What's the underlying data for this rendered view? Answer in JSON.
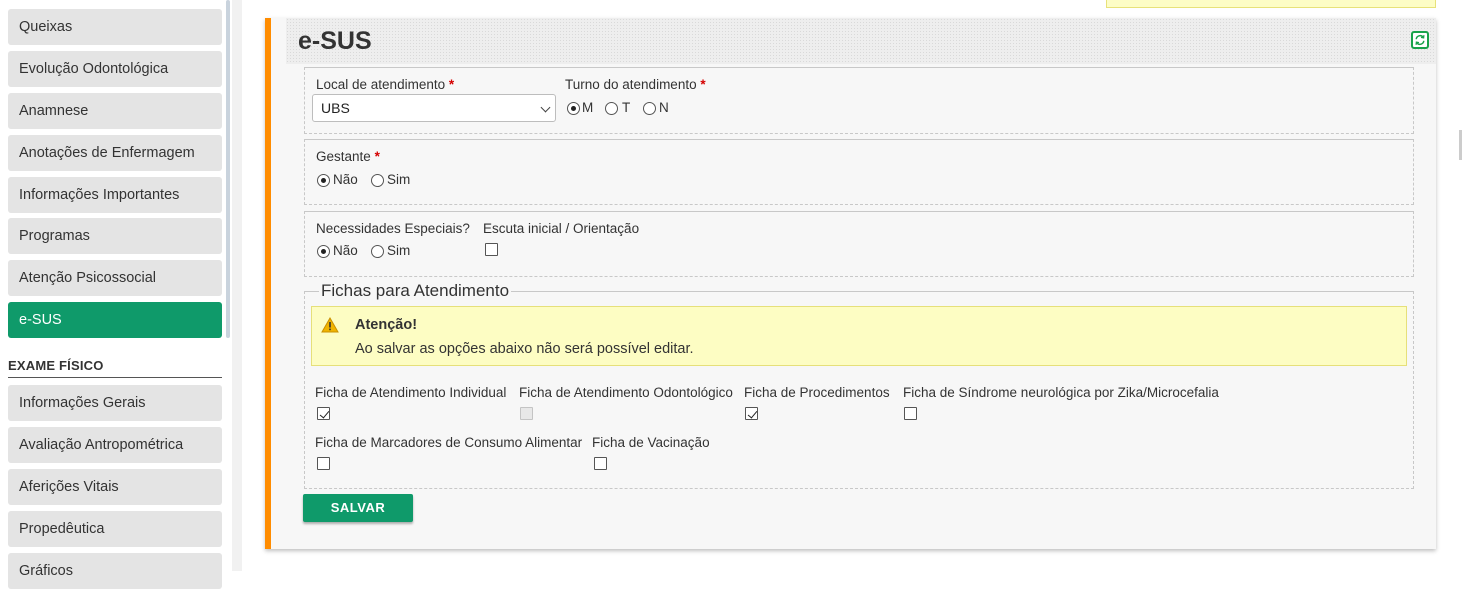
{
  "sidebar": {
    "items": [
      {
        "label": "Queixas"
      },
      {
        "label": "Evolução Odontológica"
      },
      {
        "label": "Anamnese"
      },
      {
        "label": "Anotações de Enfermagem"
      },
      {
        "label": "Informações Importantes"
      },
      {
        "label": "Programas"
      },
      {
        "label": "Atenção Psicossocial"
      },
      {
        "label": "e-SUS",
        "active": true
      }
    ],
    "section_title": "EXAME FÍSICO",
    "exam_items": [
      {
        "label": "Informações Gerais"
      },
      {
        "label": "Avaliação Antropométrica"
      },
      {
        "label": "Aferições Vitais"
      },
      {
        "label": "Propedêutica"
      },
      {
        "label": "Gráficos"
      }
    ]
  },
  "panel": {
    "title": "e-SUS",
    "refresh_icon": "refresh-icon",
    "accent_color": "#ff8c00"
  },
  "form": {
    "local": {
      "label": "Local de atendimento",
      "required": "*",
      "value": "UBS"
    },
    "turno": {
      "label": "Turno do atendimento",
      "required": "*",
      "options": [
        "M",
        "T",
        "N"
      ],
      "selected": "M"
    },
    "gestante": {
      "label": "Gestante",
      "required": "*",
      "options": [
        "Não",
        "Sim"
      ],
      "selected": "Não"
    },
    "necessidades": {
      "label": "Necessidades Especiais?",
      "options": [
        "Não",
        "Sim"
      ],
      "selected": "Não"
    },
    "escuta": {
      "label": "Escuta inicial / Orientação",
      "checked": false
    }
  },
  "fichas": {
    "legend": "Fichas para Atendimento",
    "alert_title": "Atenção!",
    "alert_text": "Ao salvar as opções abaixo não será possível editar.",
    "items": [
      {
        "label": "Ficha de Atendimento Individual",
        "checked": true
      },
      {
        "label": "Ficha de Atendimento Odontológico",
        "checked": false,
        "disabled": true
      },
      {
        "label": "Ficha de Procedimentos",
        "checked": true
      },
      {
        "label": "Ficha de Síndrome neurológica por Zika/Microcefalia",
        "checked": false
      },
      {
        "label": "Ficha de Marcadores de Consumo Alimentar",
        "checked": false
      },
      {
        "label": "Ficha de Vacinação",
        "checked": false
      }
    ]
  },
  "actions": {
    "save_label": "SALVAR",
    "save_color": "#0f9a6a"
  }
}
